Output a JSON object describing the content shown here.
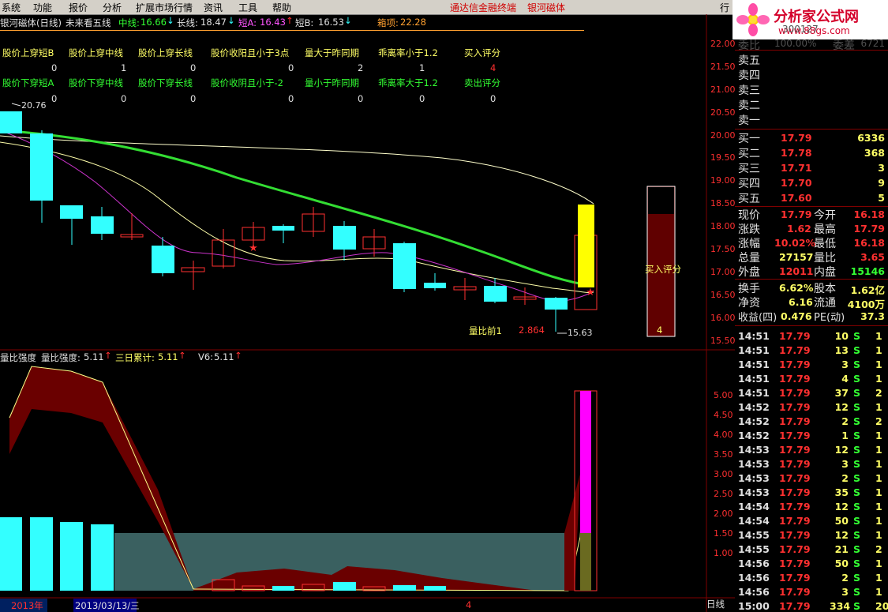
{
  "menu": {
    "items": [
      "系统",
      "功能",
      "报价",
      "分析",
      "扩展市场行情",
      "资讯",
      "工具",
      "帮助"
    ],
    "promo": "通达信金融终端",
    "bank": "银河磁体",
    "right_btn": "行"
  },
  "logo": {
    "brand": "分析家公式网",
    "url": "www.88gs.com"
  },
  "header": {
    "stock": "银河磁体(日线)",
    "forecast": "未来看五线",
    "mid_label": "中线:",
    "mid_value": "16.66",
    "long_label": "长线:",
    "long_value": "18.47",
    "shortA_label": "短A:",
    "shortA_value": "16.43",
    "shortB_label": "短B:",
    "shortB_value": "16.53",
    "box_label": "箱项:",
    "box_value": "22.28"
  },
  "signals": {
    "buy_headers": [
      "股价上穿短B",
      "股价上穿中线",
      "股价上穿长线",
      "股价收阳且小于3点",
      "量大于昨同期",
      "乖离率小于1.2",
      "买入评分"
    ],
    "buy_values": [
      "0",
      "1",
      "0",
      "0",
      "2",
      "1",
      "4"
    ],
    "sell_headers": [
      "股价下穿短A",
      "股价下穿中线",
      "股价下穿长线",
      "股价收阴且小于-2",
      "量小于昨同期",
      "乖离率大于1.2",
      "卖出评分"
    ],
    "sell_values": [
      "0",
      "0",
      "0",
      "0",
      "0",
      "0",
      "0"
    ]
  },
  "main_chart": {
    "high_label": "20.76",
    "low_label": "15.63",
    "vr_label": "量比前1",
    "vr_value": "2.864",
    "score_label": "买入评分",
    "score_value": "4",
    "axis": [
      "22.00",
      "21.50",
      "21.00",
      "20.50",
      "20.00",
      "19.50",
      "19.00",
      "18.50",
      "18.00",
      "17.50",
      "17.00",
      "16.50",
      "16.00",
      "15.50"
    ]
  },
  "lower_chart": {
    "title": "量比强度",
    "k1_label": "量比强度:",
    "k1_value": "5.11",
    "k2_label": "三日累计:",
    "k2_value": "5.11",
    "k3_label": "V6:",
    "k3_value": "5.11",
    "axis": [
      "5.00",
      "4.50",
      "4.00",
      "3.50",
      "3.00",
      "2.50",
      "2.00",
      "1.50",
      "1.00"
    ]
  },
  "footer": {
    "year": "2013年",
    "date": "2013/03/13/三",
    "count": "4",
    "period": "日线"
  },
  "quote": {
    "code_faint": "300127",
    "weibi_label": "委比",
    "weibi_value": "100.00%",
    "weicha_label": "委差",
    "weicha_value": "6721",
    "sell_rows": [
      "卖五",
      "卖四",
      "卖三",
      "卖二",
      "卖一"
    ],
    "buy_rows": [
      {
        "label": "买一",
        "price": "17.79",
        "vol": "6336"
      },
      {
        "label": "买二",
        "price": "17.78",
        "vol": "368"
      },
      {
        "label": "买三",
        "price": "17.71",
        "vol": "3"
      },
      {
        "label": "买四",
        "price": "17.70",
        "vol": "9"
      },
      {
        "label": "买五",
        "price": "17.60",
        "vol": "5"
      }
    ],
    "stats": [
      {
        "l1": "现价",
        "v1": "17.79",
        "l2": "今开",
        "v2": "16.18"
      },
      {
        "l1": "涨跌",
        "v1": "1.62",
        "l2": "最高",
        "v2": "17.79"
      },
      {
        "l1": "涨幅",
        "v1": "10.02%",
        "l2": "最低",
        "v2": "16.18"
      },
      {
        "l1": "总量",
        "v1": "27157",
        "l2": "量比",
        "v2": "3.65"
      },
      {
        "l1": "外盘",
        "v1": "12011",
        "l2": "内盘",
        "v2": "15146"
      },
      {
        "l1": "换手",
        "v1": "6.62%",
        "l2": "股本",
        "v2": "1.62亿"
      },
      {
        "l1": "净资",
        "v1": "6.16",
        "l2": "流通",
        "v2": "4100万"
      },
      {
        "l1": "收益(四)",
        "v1": "0.476",
        "l2": "PE(动)",
        "v2": "37.3"
      }
    ],
    "ticks": [
      {
        "t": "14:51",
        "p": "17.79",
        "v": "10",
        "s": "S",
        "n": "1"
      },
      {
        "t": "14:51",
        "p": "17.79",
        "v": "13",
        "s": "S",
        "n": "1"
      },
      {
        "t": "14:51",
        "p": "17.79",
        "v": "3",
        "s": "S",
        "n": "1"
      },
      {
        "t": "14:51",
        "p": "17.79",
        "v": "4",
        "s": "S",
        "n": "1"
      },
      {
        "t": "14:51",
        "p": "17.79",
        "v": "37",
        "s": "S",
        "n": "2"
      },
      {
        "t": "14:52",
        "p": "17.79",
        "v": "12",
        "s": "S",
        "n": "1"
      },
      {
        "t": "14:52",
        "p": "17.79",
        "v": "2",
        "s": "S",
        "n": "2"
      },
      {
        "t": "14:52",
        "p": "17.79",
        "v": "1",
        "s": "S",
        "n": "1"
      },
      {
        "t": "14:53",
        "p": "17.79",
        "v": "12",
        "s": "S",
        "n": "1"
      },
      {
        "t": "14:53",
        "p": "17.79",
        "v": "3",
        "s": "S",
        "n": "1"
      },
      {
        "t": "14:53",
        "p": "17.79",
        "v": "2",
        "s": "S",
        "n": "1"
      },
      {
        "t": "14:53",
        "p": "17.79",
        "v": "35",
        "s": "S",
        "n": "1"
      },
      {
        "t": "14:54",
        "p": "17.79",
        "v": "12",
        "s": "S",
        "n": "1"
      },
      {
        "t": "14:54",
        "p": "17.79",
        "v": "50",
        "s": "S",
        "n": "1"
      },
      {
        "t": "14:55",
        "p": "17.79",
        "v": "12",
        "s": "S",
        "n": "1"
      },
      {
        "t": "14:55",
        "p": "17.79",
        "v": "21",
        "s": "S",
        "n": "2"
      },
      {
        "t": "14:56",
        "p": "17.79",
        "v": "50",
        "s": "S",
        "n": "1"
      },
      {
        "t": "14:56",
        "p": "17.79",
        "v": "2",
        "s": "S",
        "n": "1"
      },
      {
        "t": "14:56",
        "p": "17.79",
        "v": "3",
        "s": "S",
        "n": "1"
      },
      {
        "t": "15:00",
        "p": "17.79",
        "v": "334",
        "s": "S",
        "n": "20"
      }
    ]
  },
  "colors": {
    "up": "#ff3030",
    "down": "#33ffff",
    "mid_line": "#33dd33",
    "long_line": "#ffffcc",
    "shortA": "#cc33cc",
    "shortB": "#ffffaa",
    "score": "#ffff00",
    "strength": "#ff00ff"
  }
}
